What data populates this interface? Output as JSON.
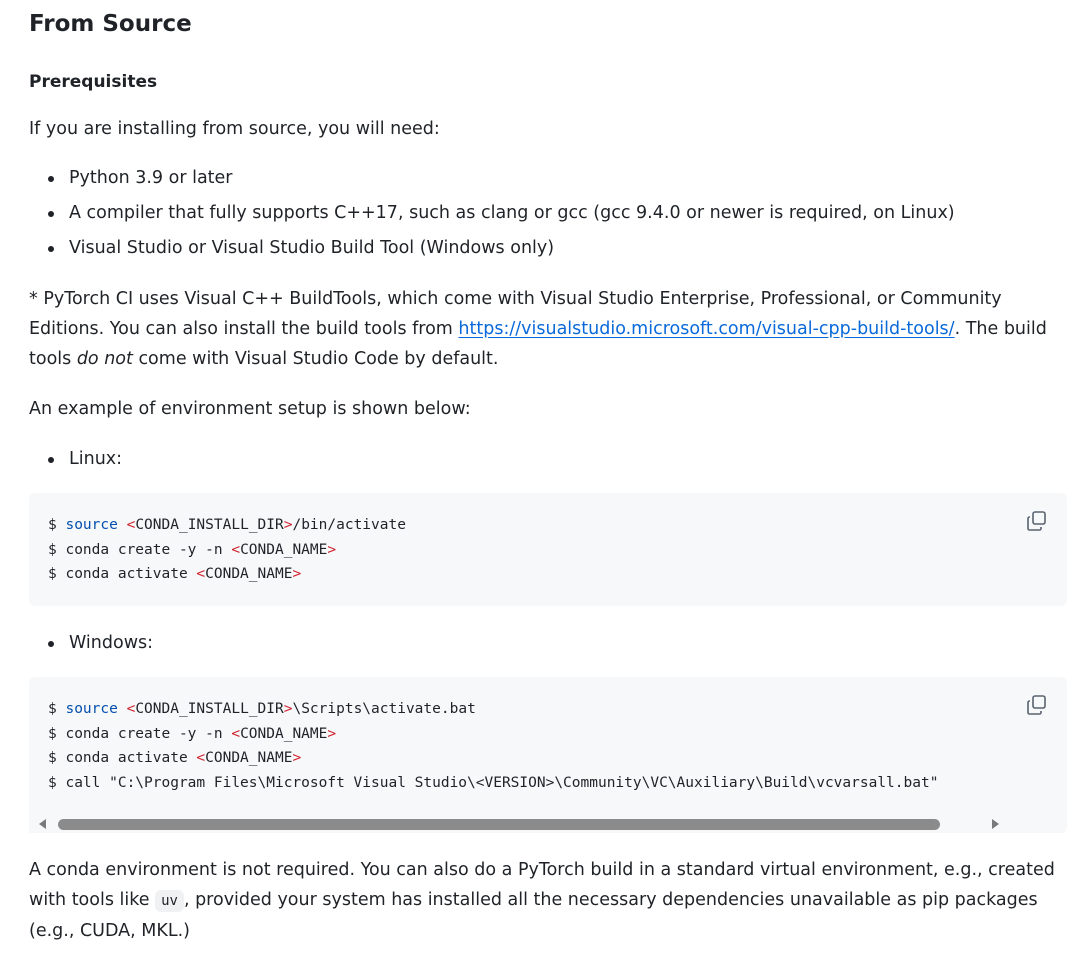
{
  "section": {
    "title": "From Source",
    "prerequisites_heading": "Prerequisites",
    "intro": "If you are installing from source, you will need:",
    "requirements": [
      "Python 3.9 or later",
      "A compiler that fully supports C++17, such as clang or gcc (gcc 9.4.0 or newer is required, on Linux)",
      "Visual Studio or Visual Studio Build Tool (Windows only)"
    ],
    "note": {
      "text_1": "* PyTorch CI uses Visual C++ BuildTools, which come with Visual Studio Enterprise, Professional, or Community Editions. You can also install the build tools from ",
      "link": "https://visualstudio.microsoft.com/visual-cpp-build-tools/",
      "text_2": ". The build tools ",
      "emphasis": "do not",
      "text_3": " come with Visual Studio Code by default."
    },
    "example_intro": "An example of environment setup is shown below:",
    "linux_label": "Linux:",
    "windows_label": "Windows:",
    "linux_code": {
      "l1_prompt": "$ ",
      "l1_cmd": "source",
      "l1_lt": " <",
      "l1_var": "CONDA_INSTALL_DIR",
      "l1_gt": ">",
      "l1_rest": "/bin/activate",
      "l2_prompt": "$ conda create -y -n ",
      "l2_lt": "<",
      "l2_var": "CONDA_NAME",
      "l2_gt": ">",
      "l3_prompt": "$ conda activate ",
      "l3_lt": "<",
      "l3_var": "CONDA_NAME",
      "l3_gt": ">"
    },
    "windows_code": {
      "l1_prompt": "$ ",
      "l1_cmd": "source",
      "l1_lt": " <",
      "l1_var": "CONDA_INSTALL_DIR",
      "l1_gt": ">",
      "l1_rest": "\\Scripts\\activate.bat",
      "l2_prompt": "$ conda create -y -n ",
      "l2_lt": "<",
      "l2_var": "CONDA_NAME",
      "l2_gt": ">",
      "l3_prompt": "$ conda activate ",
      "l3_lt": "<",
      "l3_var": "CONDA_NAME",
      "l3_gt": ">",
      "l4": "$ call \"C:\\Program Files\\Microsoft Visual Studio\\<VERSION>\\Community\\VC\\Auxiliary\\Build\\vcvarsall.bat\""
    },
    "final": {
      "text_1": "A conda environment is not required. You can also do a PyTorch build in a standard virtual environment, e.g., created with tools like ",
      "code": "uv",
      "text_2": ", provided your system has installed all the necessary dependencies unavailable as pip packages (e.g., CUDA, MKL.)"
    },
    "icons": {
      "copy": "copy-icon",
      "scroll_left": "scroll-left-arrow-icon",
      "scroll_right": "scroll-right-arrow-icon"
    }
  }
}
